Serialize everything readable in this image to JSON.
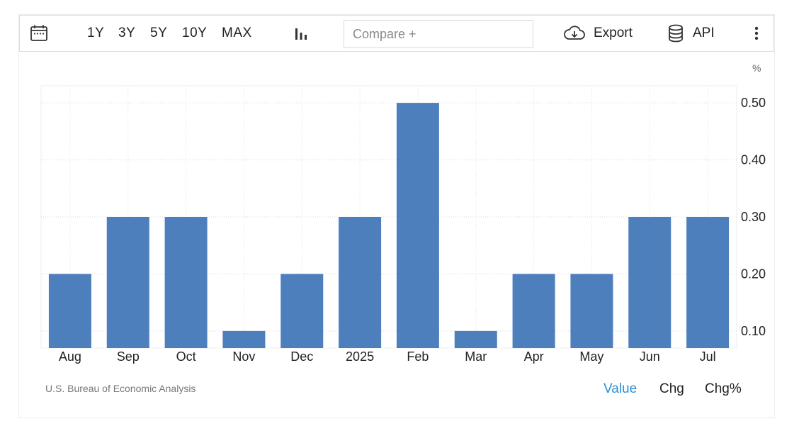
{
  "toolbar": {
    "ranges": [
      "1Y",
      "3Y",
      "5Y",
      "10Y",
      "MAX"
    ],
    "compare_placeholder": "Compare +",
    "export_label": "Export",
    "api_label": "API",
    "icons": [
      "calendar-icon",
      "bar-chart-icon",
      "cloud-download-icon",
      "database-icon",
      "more-vertical-icon"
    ]
  },
  "chart_data": {
    "type": "bar",
    "categories": [
      "Aug",
      "Sep",
      "Oct",
      "Nov",
      "Dec",
      "2025",
      "Feb",
      "Mar",
      "Apr",
      "May",
      "Jun",
      "Jul"
    ],
    "values": [
      0.2,
      0.3,
      0.3,
      0.1,
      0.2,
      0.3,
      0.5,
      0.1,
      0.2,
      0.2,
      0.3,
      0.3
    ],
    "unit": "%",
    "yticks": [
      "0.10",
      "0.20",
      "0.30",
      "0.40",
      "0.50"
    ],
    "ytick_values": [
      0.1,
      0.2,
      0.3,
      0.4,
      0.5
    ],
    "ylim": [
      0.07,
      0.53
    ],
    "bar_color": "#4e7fbd",
    "grid": true,
    "y_axis_side": "right"
  },
  "footer": {
    "source": "U.S. Bureau of Economic Analysis",
    "views": [
      "Value",
      "Chg",
      "Chg%"
    ],
    "active_view": "Value",
    "active_color": "#2b8ed6"
  }
}
